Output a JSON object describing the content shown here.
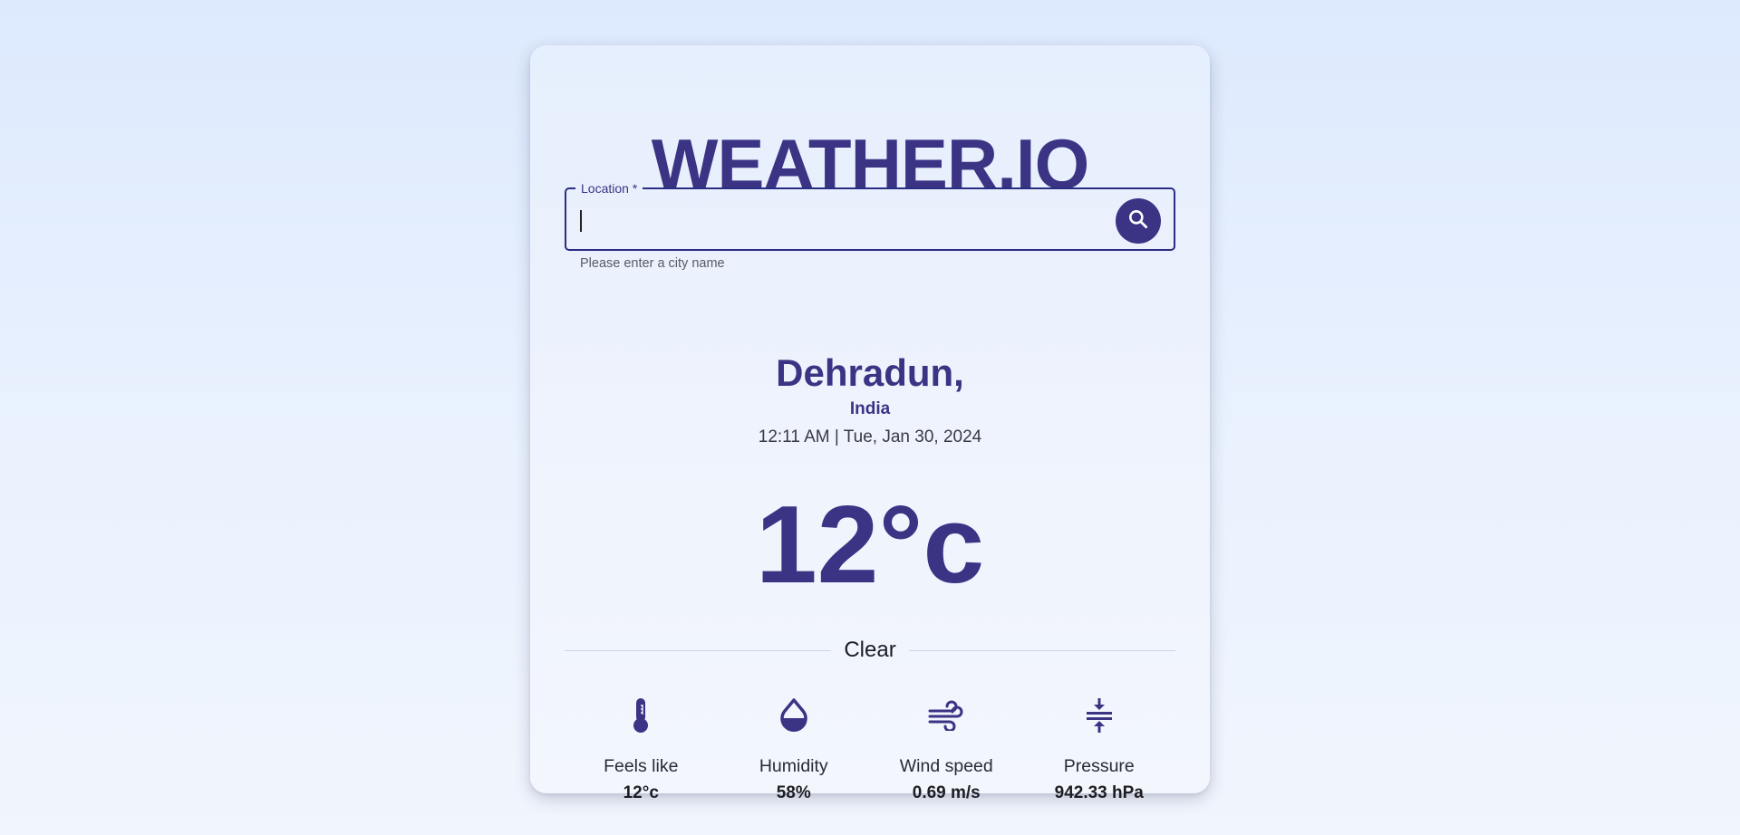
{
  "app": {
    "title": "WEATHER.IO"
  },
  "search": {
    "label": "Location *",
    "value": "",
    "helper": "Please enter a city name",
    "icon": "search-icon"
  },
  "location": {
    "city": "Dehradun,",
    "country": "India",
    "datetime": "12:11 AM | Tue, Jan 30, 2024"
  },
  "current": {
    "temperature": "12°c",
    "condition": "Clear"
  },
  "stats": [
    {
      "label": "Feels like",
      "value": "12°c",
      "icon": "thermometer-icon"
    },
    {
      "label": "Humidity",
      "value": "58%",
      "icon": "water-drop-icon"
    },
    {
      "label": "Wind speed",
      "value": "0.69 m/s",
      "icon": "wind-icon"
    },
    {
      "label": "Pressure",
      "value": "942.33 hPa",
      "icon": "pressure-icon"
    }
  ],
  "colors": {
    "accent": "#3b3485",
    "border": "#2a2d82",
    "background_top": "#dde9fd",
    "background_bottom": "#f1f5fd"
  }
}
